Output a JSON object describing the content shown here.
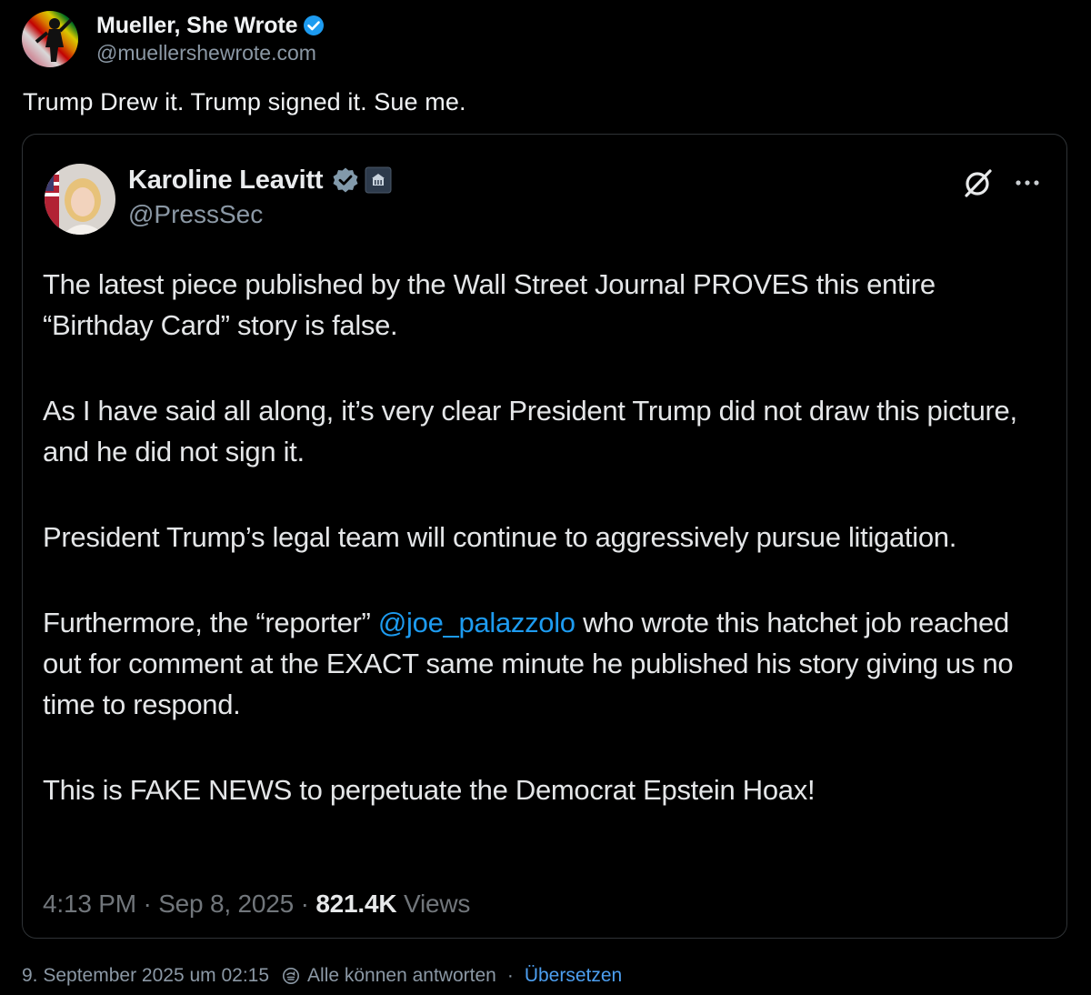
{
  "post": {
    "author_name": "Mueller, She Wrote",
    "author_handle": "@muellershewrote.com",
    "text": "Trump Drew it. Trump signed it. Sue me.",
    "timestamp": "9. September 2025 um 02:15",
    "reply_setting": "Alle können antworten",
    "separator": "·",
    "translate_label": "Übersetzen",
    "colors": {
      "background": "#000000",
      "link": "#4d9ff0",
      "verified": "#1d9bf0"
    }
  },
  "quote": {
    "author_name": "Karoline Leavitt",
    "author_handle": "@PressSec",
    "paragraphs": [
      "The latest piece published by the Wall Street Journal PROVES this entire “Birthday Card” story is false.",
      "As I have said all along, it’s very clear President Trump did not draw this picture, and he did not sign it.",
      "President Trump’s legal team will continue to aggressively pursue litigation."
    ],
    "p4_before": "Furthermore, the “reporter” ",
    "p4_mention": "@joe_palazzolo",
    "p4_after": " who wrote this hatchet job reached out for comment at the EXACT same minute he published his story giving us no time to respond.",
    "p5": "This is FAKE NEWS to perpetuate the Democrat Epstein Hoax!",
    "time": "4:13 PM",
    "date": "Sep 8, 2025",
    "meta_sep": " · ",
    "views_count": "821.4K",
    "views_label": " Views",
    "icons": {
      "verified": "verified-badge-gray-icon",
      "affiliation": "white-house-badge-icon",
      "grok": "grok-icon",
      "more": "more-icon"
    }
  }
}
